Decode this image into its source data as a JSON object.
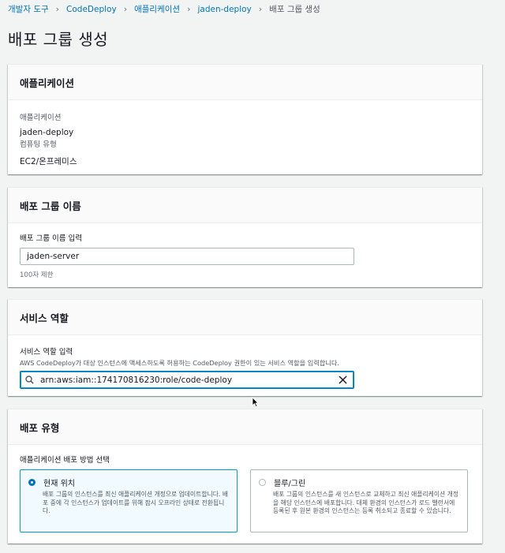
{
  "breadcrumb": {
    "items": [
      "개발자 도구",
      "CodeDeploy",
      "애플리케이션",
      "jaden-deploy"
    ],
    "current": "배포 그룹 생성"
  },
  "page_title": "배포 그룹 생성",
  "application_panel": {
    "title": "애플리케이션",
    "app_label": "애플리케이션",
    "app_value": "jaden-deploy",
    "platform_label": "컴퓨팅 유형",
    "platform_value": "EC2/온프레미스"
  },
  "group_name_panel": {
    "title": "배포 그룹 이름",
    "field_label": "배포 그룹 이름 입력",
    "value": "jaden-server",
    "hint": "100자 제한"
  },
  "service_role_panel": {
    "title": "서비스 역할",
    "field_label": "서비스 역할 입력",
    "description": "AWS CodeDeploy가 대상 인스턴스에 액세스하도록 허용하는 CodeDeploy 권한이 있는 서비스 역할을 입력합니다.",
    "value": "arn:aws:iam::174170816230:role/code-deploy"
  },
  "deployment_type_panel": {
    "title": "배포 유형",
    "field_label": "애플리케이션 배포 방법 선택",
    "options": [
      {
        "label": "현재 위치",
        "description": "배포 그룹의 인스턴스를 최신 애플리케이션 개정으로 업데이트합니다. 배포 중에 각 인스턴스가 업데이트를 위해 잠시 오프라인 상태로 전환됩니다.",
        "selected": true
      },
      {
        "label": "블루/그린",
        "description": "배포 그룹의 인스턴스를 새 인스턴스로 교체하고 최신 애플리케이션 개정을 해당 인스턴스에 배포합니다. 대체 환경의 인스턴스가 로드 밸런서에 등록된 후 원본 환경의 인스턴스는 등록 취소되고 종료할 수 있습니다.",
        "selected": false
      }
    ]
  },
  "colors": {
    "link": "#0073bb",
    "focus": "#00a1c9",
    "page_bg": "#f2f3f3"
  }
}
